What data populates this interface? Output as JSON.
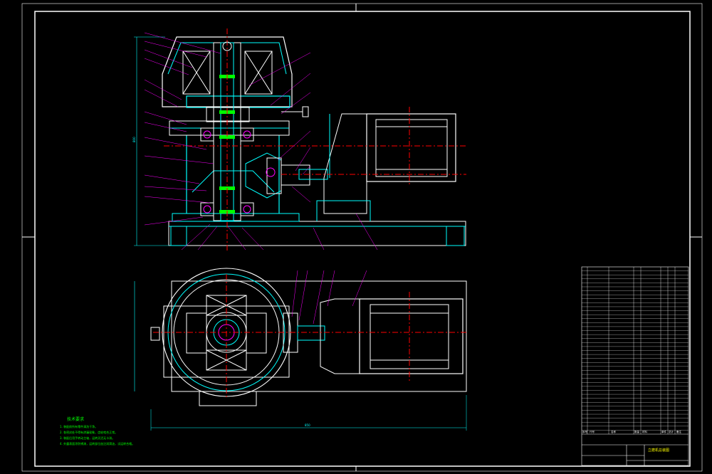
{
  "title_block": {
    "drawing_title": "立磨机总装图",
    "header_row": [
      "序号",
      "代号",
      "名称",
      "数量",
      "材料",
      "单件",
      "总计",
      "备注"
    ],
    "row_count": 42
  },
  "technical_notes": {
    "heading": "技术要求",
    "items": [
      "1. 装配前所有零件清洗干净。",
      "2. 各密封处不得有渗漏现象，齿轮啮合正常。",
      "3. 装配后用手转动主轴，运转灵活无卡滞。",
      "4. 外露表面涂防锈漆，运转部位加注润滑油，试运转合格。"
    ]
  },
  "dimensions": {
    "overall_length": "850",
    "overall_height": "800"
  },
  "colors": {
    "background": "#000000",
    "outline": "#ffffff",
    "section": "#00ffff",
    "centerline": "#ff0000",
    "annotation": "#00ff00",
    "leader": "#ff00ff",
    "label": "#ffff00"
  }
}
